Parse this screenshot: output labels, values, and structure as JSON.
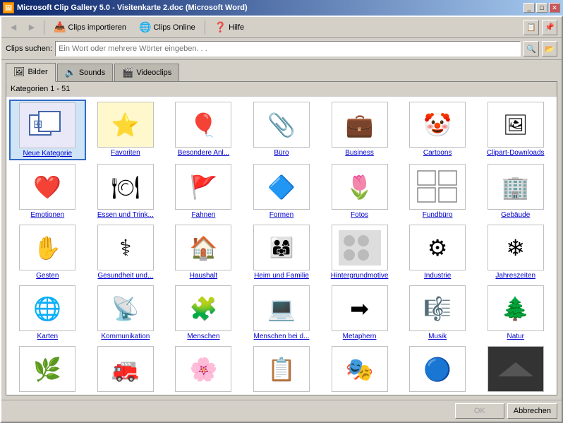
{
  "titleBar": {
    "icon": "🖼",
    "title": "Microsoft Clip Gallery 5.0 - Visitenkarte 2.doc (Microsoft Word)",
    "buttons": [
      "_",
      "□",
      "×"
    ]
  },
  "toolbar": {
    "back_label": "←",
    "forward_label": "→",
    "clips_import_label": "Clips importieren",
    "clips_online_label": "Clips Online",
    "help_label": "Hilfe"
  },
  "search": {
    "label": "Clips suchen:",
    "placeholder": "Ein Wort oder mehrere Wörter eingeben. . ."
  },
  "tabs": [
    {
      "id": "bilder",
      "label": "Bilder",
      "active": true
    },
    {
      "id": "sounds",
      "label": "Sounds",
      "active": false
    },
    {
      "id": "videoclips",
      "label": "Videoclips",
      "active": false
    }
  ],
  "categoryLabel": "Kategorien 1 - 51",
  "categories": [
    {
      "id": "neue-kategorie",
      "label": "Neue Kategorie",
      "emoji": "🔲",
      "selected": true
    },
    {
      "id": "favoriten",
      "label": "Favoriten",
      "emoji": "⭐",
      "bg": "#ffee88"
    },
    {
      "id": "besondere-anlaesse",
      "label": "Besondere Anl...",
      "emoji": "🎈"
    },
    {
      "id": "buero",
      "label": "Büro",
      "emoji": "📎"
    },
    {
      "id": "business",
      "label": "Business",
      "emoji": "💼"
    },
    {
      "id": "cartoons",
      "label": "Cartoons",
      "emoji": "🤡"
    },
    {
      "id": "clipart-downloads",
      "label": "Clipart-Downloads",
      "emoji": "🖼"
    },
    {
      "id": "emotionen",
      "label": "Emotionen",
      "emoji": "❤️"
    },
    {
      "id": "essen-und-trinken",
      "label": "Essen und Trink...",
      "emoji": "🍽"
    },
    {
      "id": "fahnen",
      "label": "Fahnen",
      "emoji": "🚩"
    },
    {
      "id": "formen",
      "label": "Formen",
      "emoji": "🔷"
    },
    {
      "id": "fotos",
      "label": "Fotos",
      "emoji": "🌷"
    },
    {
      "id": "fundbuero",
      "label": "Fundbüro",
      "emoji": "⊞"
    },
    {
      "id": "gebaeude",
      "label": "Gebäude",
      "emoji": "🏢"
    },
    {
      "id": "gesten",
      "label": "Gesten",
      "emoji": "✋"
    },
    {
      "id": "gesundheit",
      "label": "Gesundheit und...",
      "emoji": "⚕"
    },
    {
      "id": "haushalt",
      "label": "Haushalt",
      "emoji": "🏠"
    },
    {
      "id": "heim-und-familie",
      "label": "Heim und Familie",
      "emoji": "👨‍👩‍👧"
    },
    {
      "id": "hintergrundmotive",
      "label": "Hintergrundmotive",
      "emoji": "⬛"
    },
    {
      "id": "industrie",
      "label": "Industrie",
      "emoji": "⚙"
    },
    {
      "id": "jahreszeiten",
      "label": "Jahreszeiten",
      "emoji": "❄"
    },
    {
      "id": "karten",
      "label": "Karten",
      "emoji": "🌐"
    },
    {
      "id": "kommunikation",
      "label": "Kommunikation",
      "emoji": "📡"
    },
    {
      "id": "menschen",
      "label": "Menschen",
      "emoji": "🧩"
    },
    {
      "id": "menschen-bei",
      "label": "Menschen bei d...",
      "emoji": "💻"
    },
    {
      "id": "metaphern",
      "label": "Metaphern",
      "emoji": "➡"
    },
    {
      "id": "musik",
      "label": "Musik",
      "emoji": "🎼"
    },
    {
      "id": "natur",
      "label": "Natur",
      "emoji": "🌲"
    },
    {
      "id": "cat29",
      "label": "",
      "emoji": "🌿"
    },
    {
      "id": "cat30",
      "label": "",
      "emoji": "🚒"
    },
    {
      "id": "cat31",
      "label": "",
      "emoji": "🌸"
    },
    {
      "id": "cat32",
      "label": "",
      "emoji": "📋"
    },
    {
      "id": "cat33",
      "label": "",
      "emoji": "🎭"
    },
    {
      "id": "cat34",
      "label": "",
      "emoji": "🔵"
    },
    {
      "id": "cat35",
      "label": "",
      "emoji": "▬"
    }
  ],
  "buttons": {
    "ok_label": "OK",
    "cancel_label": "Abbrechen"
  }
}
